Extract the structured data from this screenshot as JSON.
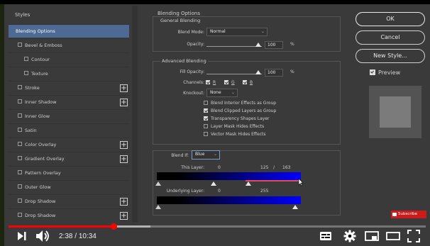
{
  "styles_panel": {
    "header": "Styles",
    "items": [
      {
        "label": "Blending Options",
        "checked": null,
        "selected": true,
        "plus": false
      },
      {
        "label": "Bevel & Emboss",
        "checked": false,
        "selected": false,
        "plus": false
      },
      {
        "label": "Contour",
        "checked": false,
        "selected": false,
        "plus": false,
        "sub": true
      },
      {
        "label": "Texture",
        "checked": false,
        "selected": false,
        "plus": false,
        "sub": true
      },
      {
        "label": "Stroke",
        "checked": false,
        "selected": false,
        "plus": true
      },
      {
        "label": "Inner Shadow",
        "checked": false,
        "selected": false,
        "plus": true
      },
      {
        "label": "Inner Glow",
        "checked": false,
        "selected": false,
        "plus": false
      },
      {
        "label": "Satin",
        "checked": false,
        "selected": false,
        "plus": false
      },
      {
        "label": "Color Overlay",
        "checked": false,
        "selected": false,
        "plus": true
      },
      {
        "label": "Gradient Overlay",
        "checked": false,
        "selected": false,
        "plus": true
      },
      {
        "label": "Pattern Overlay",
        "checked": false,
        "selected": false,
        "plus": false
      },
      {
        "label": "Outer Glow",
        "checked": false,
        "selected": false,
        "plus": false
      },
      {
        "label": "Drop Shadow",
        "checked": false,
        "selected": false,
        "plus": true
      },
      {
        "label": "Drop Shadow",
        "checked": false,
        "selected": false,
        "plus": true
      }
    ]
  },
  "blending": {
    "title": "Blending Options",
    "general": {
      "title": "General Blending",
      "blend_mode_label": "Blend Mode:",
      "blend_mode_value": "Normal",
      "opacity_label": "Opacity:",
      "opacity_value": "100",
      "percent": "%"
    },
    "advanced": {
      "title": "Advanced Blending",
      "fill_opacity_label": "Fill Opacity:",
      "fill_opacity_value": "100",
      "percent": "%",
      "channels_label": "Channels:",
      "channel_r": "R",
      "channel_g": "G",
      "channel_b": "B",
      "knockout_label": "Knockout:",
      "knockout_value": "None",
      "options": [
        {
          "label": "Blend Interior Effects as Group",
          "checked": false
        },
        {
          "label": "Blend Clipped Layers as Group",
          "checked": true
        },
        {
          "label": "Transparency Shapes Layer",
          "checked": true
        },
        {
          "label": "Layer Mask Hides Effects",
          "checked": false
        },
        {
          "label": "Vector Mask Hides Effects",
          "checked": false
        }
      ]
    },
    "blend_if": {
      "label": "Blend If:",
      "value": "Blue",
      "this_layer_label": "This Layer:",
      "this_layer_low": "0",
      "this_layer_split_a": "125",
      "this_layer_sep": "/",
      "this_layer_split_b": "163",
      "underlying_label": "Underlying Layer:",
      "underlying_low": "0",
      "underlying_high": "255"
    }
  },
  "buttons": {
    "ok": "OK",
    "cancel": "Cancel",
    "new_style": "New Style...",
    "preview": "Preview"
  },
  "video": {
    "time_current": "2:38",
    "time_sep": " / ",
    "time_total": "10:34",
    "progress_fraction": 0.252,
    "buffered_fraction": 0.34,
    "subscribe": "Subscribe"
  },
  "colors": {
    "selection": "#4c6a93",
    "progress": "#ff0000",
    "subscribe": "#cc1b1b",
    "blend_blue": "#0000ff"
  }
}
